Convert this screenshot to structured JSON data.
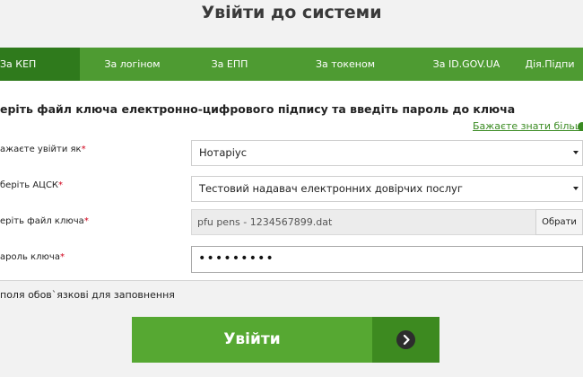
{
  "page": {
    "title": "Увійти до системи"
  },
  "tabs": [
    {
      "label": "За КЕП",
      "active": true
    },
    {
      "label": "За логіном",
      "active": false
    },
    {
      "label": "За ЕПП",
      "active": false
    },
    {
      "label": "За токеном",
      "active": false
    },
    {
      "label": "За ID.GOV.UA",
      "active": false
    },
    {
      "label": "Дія.Підпи",
      "active": false
    }
  ],
  "form": {
    "instruction": "еріть файл ключа електронно-цифрового підпису та введіть пароль до ключа",
    "learn_more": "Бажаєте знати більше",
    "login_as": {
      "label": "ажаєте увійти як",
      "required_mark": "*",
      "value": "Нотаріус"
    },
    "acsk": {
      "label": "беріть АЦСК",
      "required_mark": "*",
      "value": "Тестовий надавач електронних довірчих послуг"
    },
    "key_file": {
      "label": "еріть файл ключа",
      "required_mark": "*",
      "value": "pfu pens - 1234567899.dat",
      "browse_label": "Обрати"
    },
    "password": {
      "label": "ароль ключа",
      "required_mark": "*",
      "value": "•••••••••"
    },
    "required_note": "поля обов`язкові для заповнення",
    "submit_label": "Увійти"
  },
  "colors": {
    "tab_bar": "#4e9b32",
    "tab_active": "#2f7a1c",
    "submit": "#56a832",
    "submit_dark": "#3d8a20",
    "link": "#3a8b22",
    "required": "#d0021b"
  },
  "icons": {
    "help": "info-circle-icon",
    "dropdown": "chevron-down-icon",
    "submit": "arrow-right-circle-icon"
  }
}
